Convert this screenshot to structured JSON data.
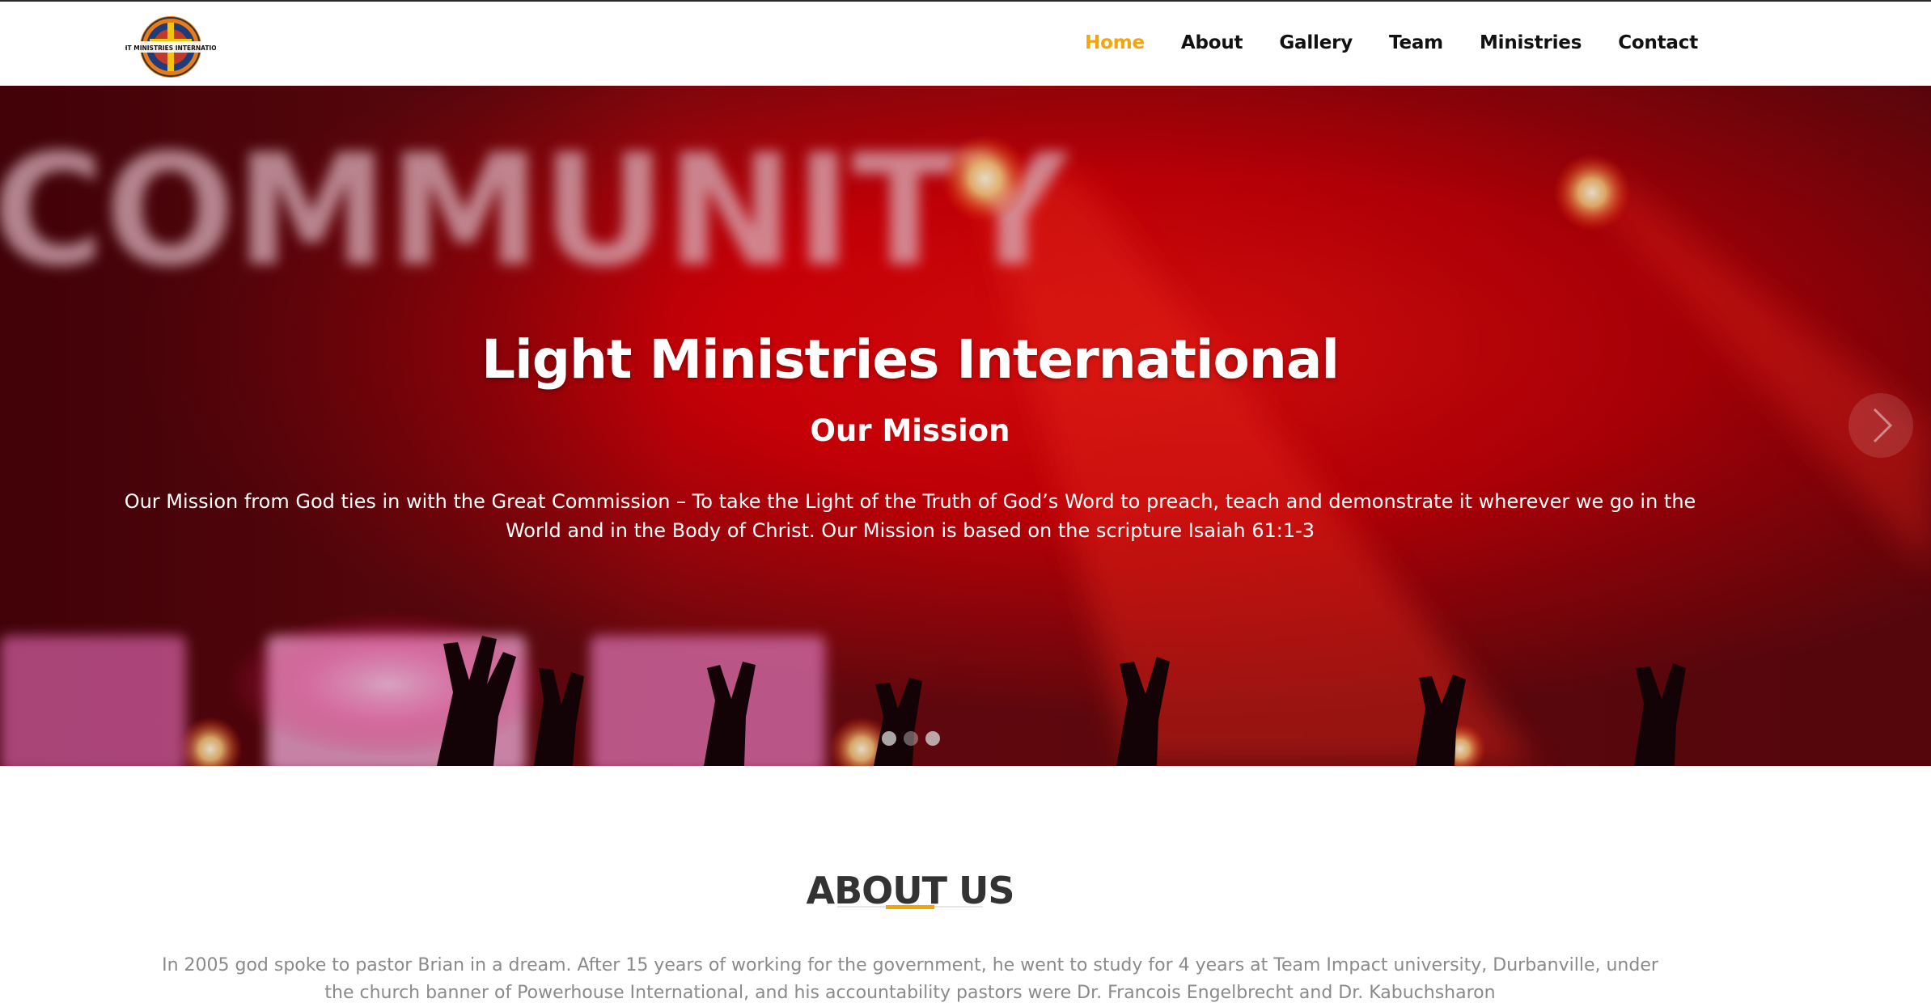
{
  "colors": {
    "accent": "#f5a40a",
    "nav_text": "#111111",
    "hero_red": "#ff0000",
    "body_text": "#8a8a8a",
    "heading": "#333333"
  },
  "header": {
    "logo_text": "LIGHT MINISTRIES INTERNATIONAL",
    "nav": [
      {
        "label": "Home",
        "active": true
      },
      {
        "label": "About"
      },
      {
        "label": "Gallery"
      },
      {
        "label": "Team"
      },
      {
        "label": "Ministries"
      },
      {
        "label": "Contact"
      }
    ]
  },
  "hero": {
    "background_text": "COMMUNITY",
    "title": "Light Ministries International",
    "subtitle": "Our Mission",
    "text": "Our Mission from God ties in with the Great Commission – To take the Light of the Truth of God’s Word to preach, teach and demonstrate it wherever we go in the World and in the Body of Christ. Our Mission is based on the scripture Isaiah 61:1-3",
    "next_icon": "chevron-right-icon",
    "slides": 3,
    "active_slide": 2
  },
  "about": {
    "title": "ABOUT US",
    "text": "In 2005 god spoke to pastor Brian in a dream. After 15 years of working for the government, he went to study for 4 years at Team Impact university, Durbanville, under the church banner of Powerhouse International, and his accountability pastors were Dr. Francois Engelbrecht and Dr. Kabuchsharon"
  }
}
